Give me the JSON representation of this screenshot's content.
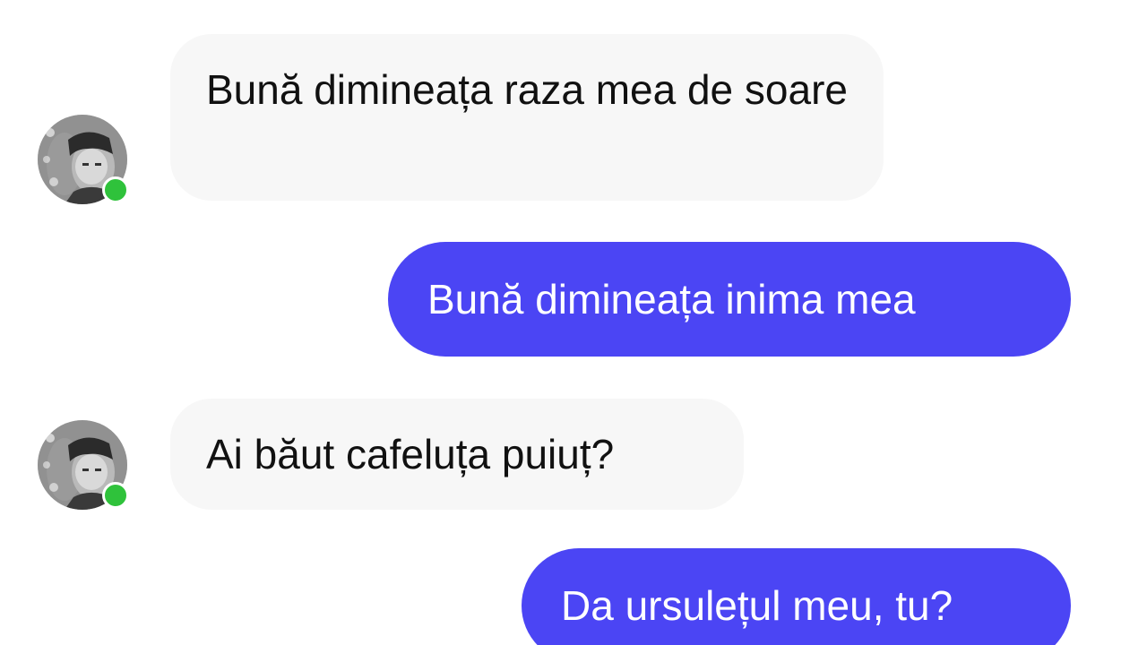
{
  "colors": {
    "incoming_bubble": "#f7f7f7",
    "incoming_text": "#111111",
    "outgoing_bubble": "#4b45f4",
    "outgoing_text": "#ffffff",
    "online_dot": "#2fc23b"
  },
  "contact": {
    "avatar_icon": "contact-avatar-photo",
    "status_icon": "online-dot"
  },
  "messages": [
    {
      "direction": "incoming",
      "text": "Bună dimineața raza mea de soare"
    },
    {
      "direction": "outgoing",
      "text": "Bună dimineața inima mea"
    },
    {
      "direction": "incoming",
      "text": "Ai băut cafeluța puiuț?"
    },
    {
      "direction": "outgoing",
      "text": "Da ursulețul meu, tu?"
    }
  ]
}
